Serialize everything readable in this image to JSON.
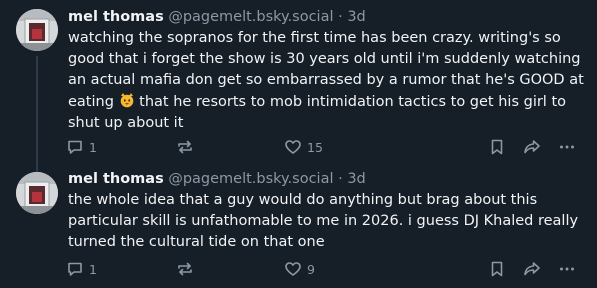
{
  "posts": [
    {
      "author_name": "mel thomas",
      "author_handle": "@pagemelt.bsky.social",
      "separator": "·",
      "timestamp": "3d",
      "text_before_emoji": "watching the sopranos for the first time has been crazy. writing's so good that i forget the show is 30 years old until i'm suddenly watching an actual mafia don get so embarrassed by a rumor that he's GOOD at eating ",
      "emoji": "cat-face-emoji",
      "text_after_emoji": " that he resorts to mob intimidation tactics to get his girl to shut up about it",
      "reply_count": "1",
      "like_count": "15"
    },
    {
      "author_name": "mel thomas",
      "author_handle": "@pagemelt.bsky.social",
      "separator": "·",
      "timestamp": "3d",
      "text": "the whole idea that a guy would do anything but brag about this particular skill is unfathomable to me in 2026. i guess DJ Khaled really turned the cultural tide on that one",
      "reply_count": "1",
      "like_count": "9"
    }
  ],
  "icons": {
    "reply": "reply-bubble-icon",
    "repost": "repost-arrows-icon",
    "like": "heart-icon",
    "bookmark": "bookmark-icon",
    "share": "share-arrow-icon",
    "more": "more-dots-icon"
  },
  "colors": {
    "background": "#161e27",
    "text_primary": "#f1f3f5",
    "text_secondary": "#8b98a5",
    "thread_line": "#2e3b4a"
  }
}
